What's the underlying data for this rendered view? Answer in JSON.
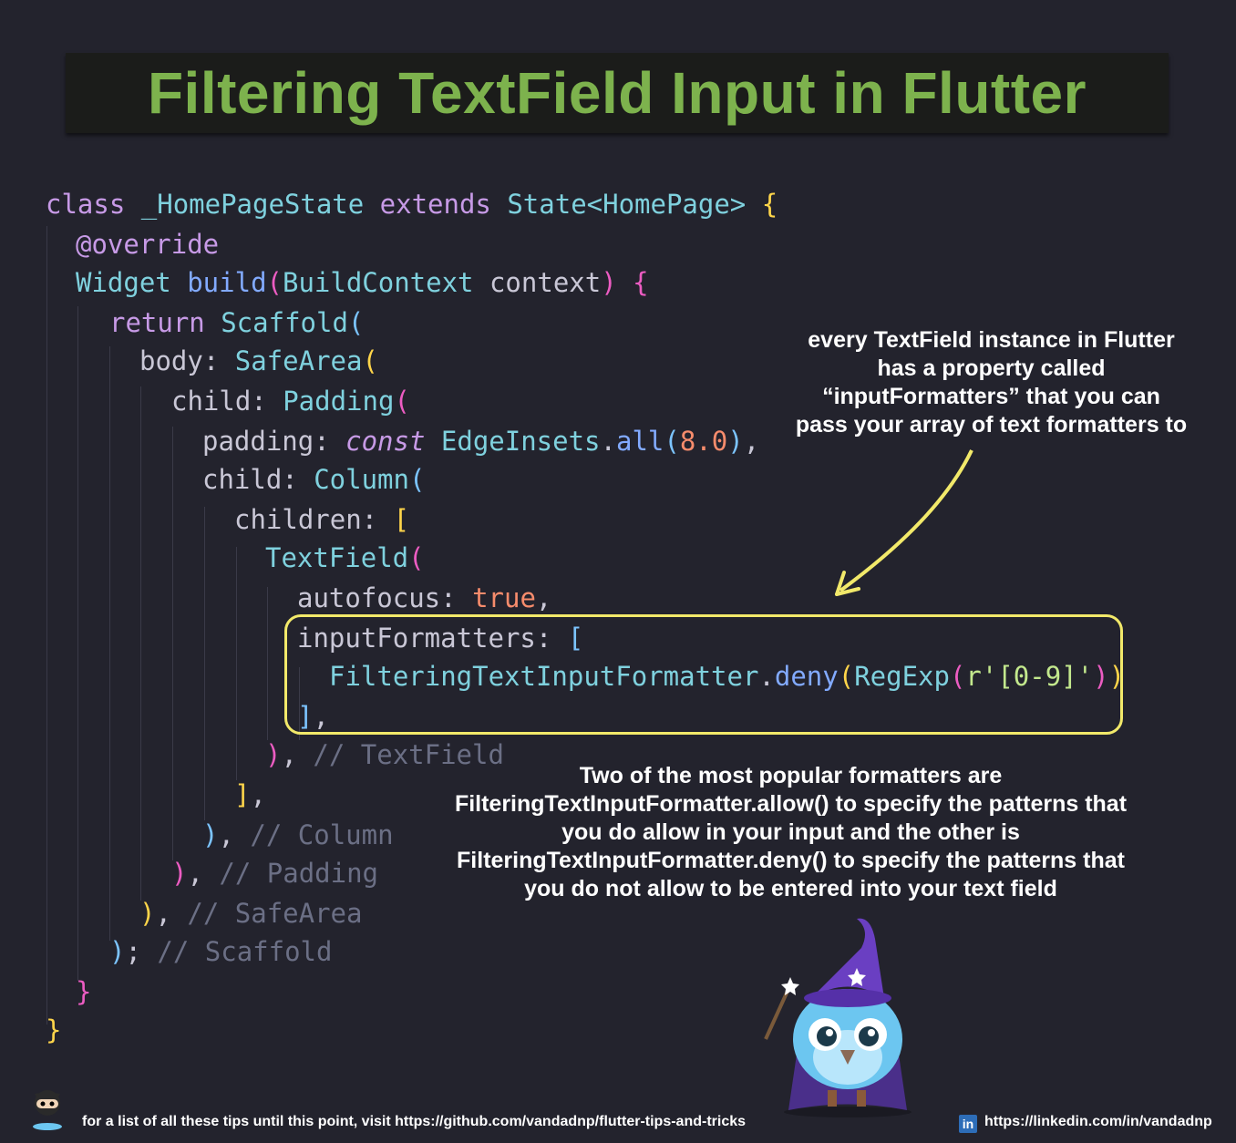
{
  "title": "Filtering TextField Input in Flutter",
  "colors": {
    "background": "#23232d",
    "title_green": "#7db24d",
    "highlight_box": "#f2e96a",
    "arrow": "#f2e96a"
  },
  "code": {
    "l1": {
      "a": "class",
      "b": " _HomePageState ",
      "c": "extends",
      "d": " State<HomePage> ",
      "e": "{"
    },
    "l2": {
      "a": "@override"
    },
    "l3": {
      "a": "Widget",
      "b": " build",
      "c": "(",
      "d": "BuildContext",
      "e": " context",
      "f": ")",
      "g": " {"
    },
    "l4": {
      "a": "return",
      "b": " Scaffold",
      "c": "("
    },
    "l5": {
      "a": "body: ",
      "b": "SafeArea",
      "c": "("
    },
    "l6": {
      "a": "child: ",
      "b": "Padding",
      "c": "("
    },
    "l7": {
      "a": "padding: ",
      "b": "const",
      "c": " EdgeInsets",
      "d": ".",
      "e": "all",
      "f": "(",
      "g": "8.0",
      "h": ")",
      "i": ","
    },
    "l8": {
      "a": "child: ",
      "b": "Column",
      "c": "("
    },
    "l9": {
      "a": "children: ",
      "b": "["
    },
    "l10": {
      "a": "TextField",
      "b": "("
    },
    "l11": {
      "a": "autofocus: ",
      "b": "true",
      "c": ","
    },
    "l12": {
      "a": "inputFormatters: ",
      "b": "["
    },
    "l13": {
      "a": "FilteringTextInputFormatter",
      "b": ".",
      "c": "deny",
      "d": "(",
      "e": "RegExp",
      "f": "(",
      "g": "r'[0-9]'",
      "h": ")",
      "i": ")"
    },
    "l14": {
      "a": "]",
      "b": ","
    },
    "l15": {
      "a": ")",
      "b": ", ",
      "c": "// TextField"
    },
    "l16": {
      "a": "]",
      "b": ","
    },
    "l17": {
      "a": ")",
      "b": ", ",
      "c": "// Column"
    },
    "l18": {
      "a": ")",
      "b": ", ",
      "c": "// Padding"
    },
    "l19": {
      "a": ")",
      "b": ", ",
      "c": "// SafeArea"
    },
    "l20": {
      "a": ")",
      "b": "; ",
      "c": "// Scaffold"
    },
    "l21": {
      "a": "}"
    },
    "l22": {
      "a": "}"
    }
  },
  "note_top": {
    "line1": "every TextField instance in Flutter",
    "line2": "has a property called",
    "line3": "“inputFormatters” that you can",
    "line4": "pass your array of text formatters to"
  },
  "note_bottom": {
    "line1": "Two of the most popular formatters are",
    "line2": "FilteringTextInputFormatter.allow() to specify the patterns that",
    "line3": "you do allow in your input and the other is",
    "line4": "FilteringTextInputFormatter.deny() to specify the patterns that",
    "line5": "you do not allow to be entered into your text field"
  },
  "footer": {
    "left_text": "for a list of all these tips until this point, visit https://github.com/vandadnp/flutter-tips-and-tricks",
    "right_text": "https://linkedin.com/in/vandadnp",
    "linkedin_badge": "in"
  },
  "icons": {
    "github": "octocat-icon",
    "linkedin": "linkedin-icon",
    "mascot": "wizard-owl-mascot"
  }
}
